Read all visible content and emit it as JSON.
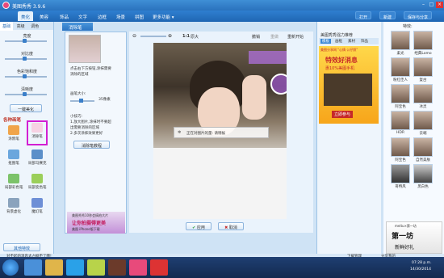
{
  "app": {
    "title": "美图秀秀 3.9.6"
  },
  "tabs": [
    {
      "label": "美化",
      "active": true
    },
    {
      "label": "美容"
    },
    {
      "label": "饰品"
    },
    {
      "label": "文字"
    },
    {
      "label": "边框"
    },
    {
      "label": "场景"
    },
    {
      "label": "拼图"
    },
    {
      "label": "更多功能 ▾"
    }
  ],
  "top_right": {
    "open": "打开",
    "new": "新建",
    "save": "保存与分享"
  },
  "left": {
    "subtabs": [
      "基础",
      "高级",
      "调色"
    ],
    "sliders": [
      "亮度",
      "对比度",
      "色彩饱和度",
      "清晰度"
    ],
    "one_click": "一键美化",
    "section": "各种画笔",
    "tools": [
      "涂鸦笔",
      "消除笔",
      "抠图笔",
      "局部马赛克",
      "局部彩色笔",
      "局部变色笔",
      "背景虚化",
      "魔幻笔"
    ],
    "bottom_button": "其他特效"
  },
  "panel": {
    "header": "消除笔",
    "tip_line1": "点击右下方按钮,涂抹需要",
    "tip_line2": "消除的区域",
    "brush_size": "画笔大小:",
    "brush_value": "35像素",
    "tips_title": "小技巧:",
    "tips": [
      "1.放大图片,涂抹时不要超",
      "出需要消除的区域",
      "2.多次涂抹效果更好"
    ],
    "button": "消除笔教程",
    "ad_line1": "美图秀秀10秒会搞拍大片",
    "ad_line2": "让你拍摄得更美",
    "ad_line3": "美图 iPhone版下载"
  },
  "canvas": {
    "zoom_label": "1:1",
    "zoom_original": "原大",
    "undo": "撤销",
    "redo": "重做",
    "reset": "重新开始",
    "tooltip": "删除",
    "processing": "正在对图片的量: 请稍候",
    "apply": "应用",
    "cancel": "取消"
  },
  "right": {
    "title": "美图秀秀强力推荐",
    "tabs": [
      "模板",
      "画框",
      "素材",
      "饰品"
    ],
    "ad_title": "特效好消息",
    "ad_sub": "惠10%美图手机",
    "ad_btn": "立即参与",
    "ad_top": "美图分享网 \"心情 公仔照\""
  },
  "far": {
    "title": "特效:",
    "thumbs": [
      "柔光",
      "经典Lomo",
      "粉红佳人",
      "复古",
      "阿宝色",
      "冰灵",
      "HDR",
      "云端",
      "阿宝色",
      "自然美肤",
      "哥特风",
      "黑白色"
    ],
    "ad_text": "第一坊",
    "ad_text2": "新鲜好礼",
    "ad_top": "meitu×第一坊"
  },
  "statusbar": {
    "left": "对不起的消息太占据不了哦!",
    "download": "下载管理",
    "share": "分享我的",
    "time": "07:28 p.m.",
    "date": "14/30/2014"
  }
}
